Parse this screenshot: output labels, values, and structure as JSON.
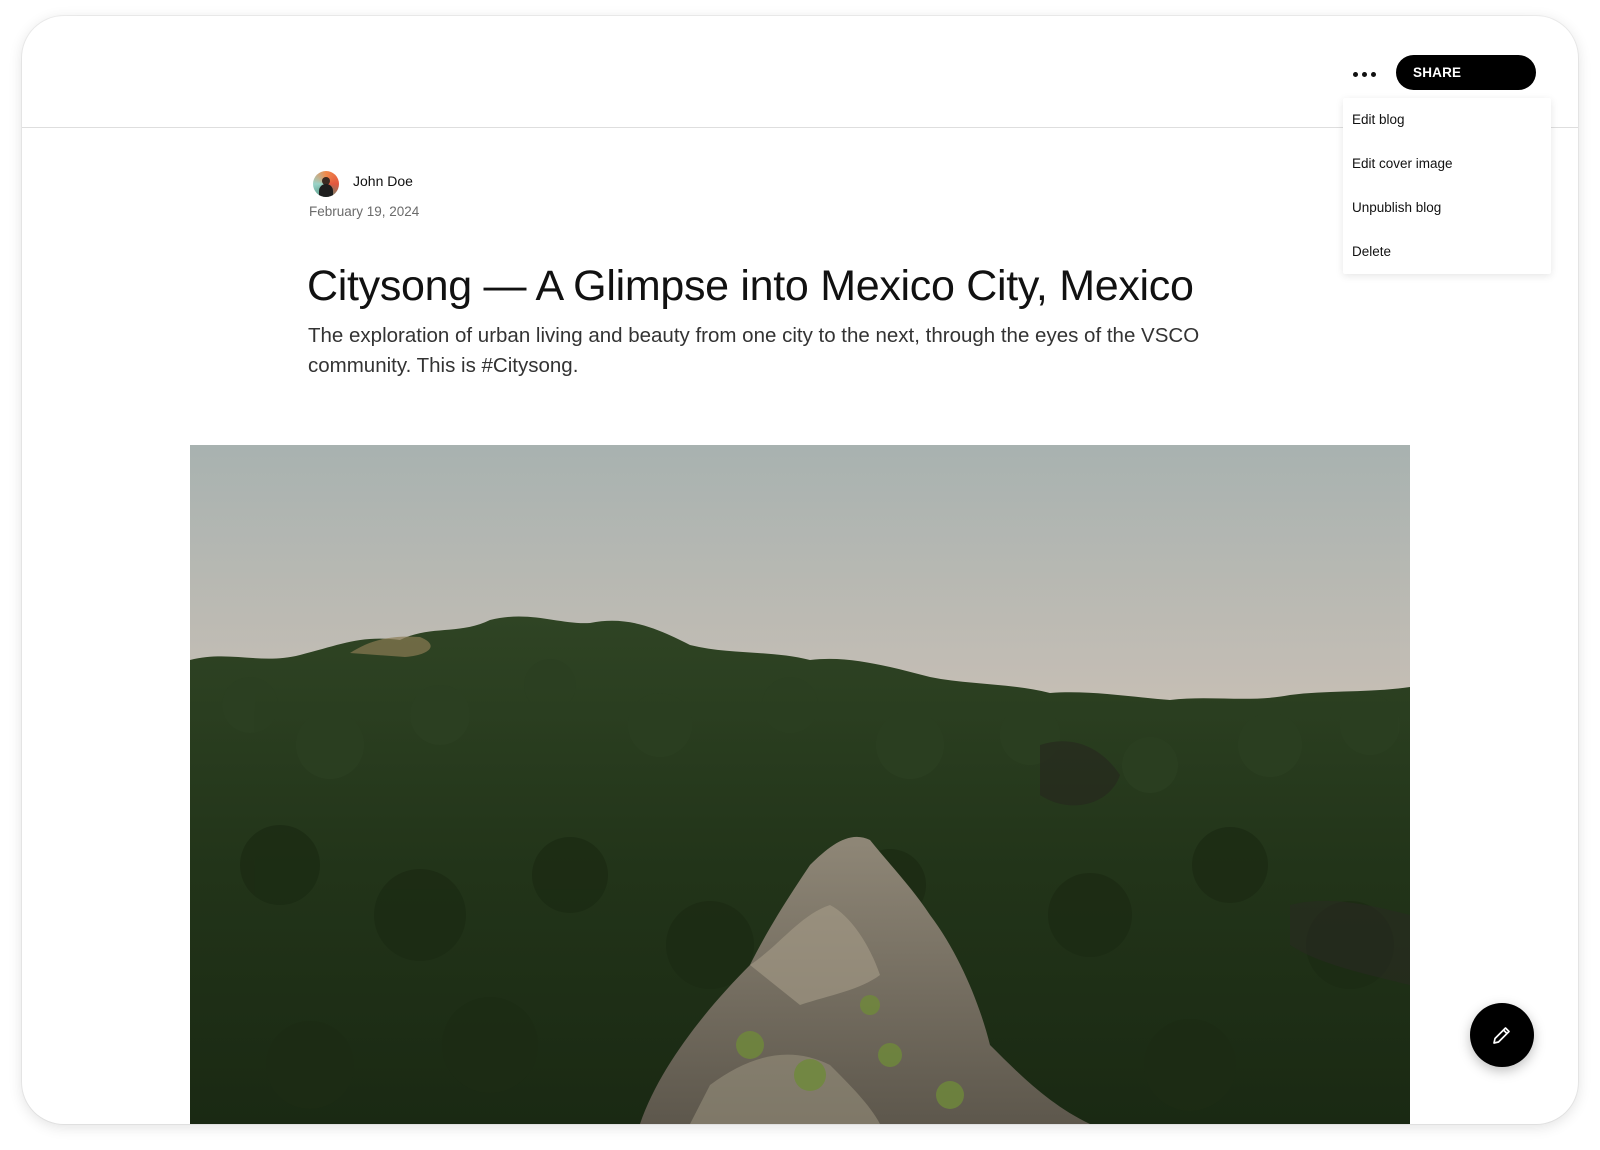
{
  "header": {
    "more_icon": "more-horizontal-icon",
    "share_label": "SHARE"
  },
  "menu": {
    "items": [
      {
        "label": "Edit blog"
      },
      {
        "label": "Edit cover image"
      },
      {
        "label": "Unpublish blog"
      },
      {
        "label": "Delete"
      }
    ]
  },
  "post": {
    "author": "John Doe",
    "date": "February 19, 2024",
    "title": "Citysong — A Glimpse into Mexico City, Mexico",
    "subtitle": "The exploration of urban living and beauty from one city to the next, through the eyes of the VSCO community. This is #Citysong."
  },
  "fab": {
    "icon": "pencil-icon"
  },
  "colors": {
    "accent": "#000000",
    "background": "#ffffff",
    "muted_text": "#6b6b6b"
  }
}
